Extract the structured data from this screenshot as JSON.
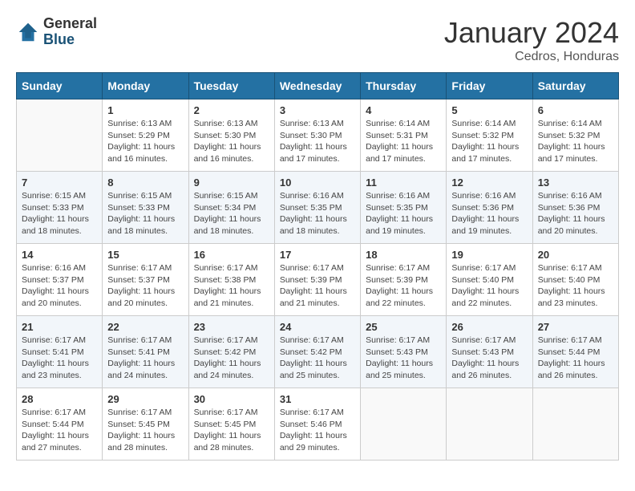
{
  "header": {
    "logo_general": "General",
    "logo_blue": "Blue",
    "month_title": "January 2024",
    "location": "Cedros, Honduras"
  },
  "days_of_week": [
    "Sunday",
    "Monday",
    "Tuesday",
    "Wednesday",
    "Thursday",
    "Friday",
    "Saturday"
  ],
  "weeks": [
    [
      {
        "day": "",
        "info": ""
      },
      {
        "day": "1",
        "info": "Sunrise: 6:13 AM\nSunset: 5:29 PM\nDaylight: 11 hours\nand 16 minutes."
      },
      {
        "day": "2",
        "info": "Sunrise: 6:13 AM\nSunset: 5:30 PM\nDaylight: 11 hours\nand 16 minutes."
      },
      {
        "day": "3",
        "info": "Sunrise: 6:13 AM\nSunset: 5:30 PM\nDaylight: 11 hours\nand 17 minutes."
      },
      {
        "day": "4",
        "info": "Sunrise: 6:14 AM\nSunset: 5:31 PM\nDaylight: 11 hours\nand 17 minutes."
      },
      {
        "day": "5",
        "info": "Sunrise: 6:14 AM\nSunset: 5:32 PM\nDaylight: 11 hours\nand 17 minutes."
      },
      {
        "day": "6",
        "info": "Sunrise: 6:14 AM\nSunset: 5:32 PM\nDaylight: 11 hours\nand 17 minutes."
      }
    ],
    [
      {
        "day": "7",
        "info": "Sunrise: 6:15 AM\nSunset: 5:33 PM\nDaylight: 11 hours\nand 18 minutes."
      },
      {
        "day": "8",
        "info": "Sunrise: 6:15 AM\nSunset: 5:33 PM\nDaylight: 11 hours\nand 18 minutes."
      },
      {
        "day": "9",
        "info": "Sunrise: 6:15 AM\nSunset: 5:34 PM\nDaylight: 11 hours\nand 18 minutes."
      },
      {
        "day": "10",
        "info": "Sunrise: 6:16 AM\nSunset: 5:35 PM\nDaylight: 11 hours\nand 18 minutes."
      },
      {
        "day": "11",
        "info": "Sunrise: 6:16 AM\nSunset: 5:35 PM\nDaylight: 11 hours\nand 19 minutes."
      },
      {
        "day": "12",
        "info": "Sunrise: 6:16 AM\nSunset: 5:36 PM\nDaylight: 11 hours\nand 19 minutes."
      },
      {
        "day": "13",
        "info": "Sunrise: 6:16 AM\nSunset: 5:36 PM\nDaylight: 11 hours\nand 20 minutes."
      }
    ],
    [
      {
        "day": "14",
        "info": "Sunrise: 6:16 AM\nSunset: 5:37 PM\nDaylight: 11 hours\nand 20 minutes."
      },
      {
        "day": "15",
        "info": "Sunrise: 6:17 AM\nSunset: 5:37 PM\nDaylight: 11 hours\nand 20 minutes."
      },
      {
        "day": "16",
        "info": "Sunrise: 6:17 AM\nSunset: 5:38 PM\nDaylight: 11 hours\nand 21 minutes."
      },
      {
        "day": "17",
        "info": "Sunrise: 6:17 AM\nSunset: 5:39 PM\nDaylight: 11 hours\nand 21 minutes."
      },
      {
        "day": "18",
        "info": "Sunrise: 6:17 AM\nSunset: 5:39 PM\nDaylight: 11 hours\nand 22 minutes."
      },
      {
        "day": "19",
        "info": "Sunrise: 6:17 AM\nSunset: 5:40 PM\nDaylight: 11 hours\nand 22 minutes."
      },
      {
        "day": "20",
        "info": "Sunrise: 6:17 AM\nSunset: 5:40 PM\nDaylight: 11 hours\nand 23 minutes."
      }
    ],
    [
      {
        "day": "21",
        "info": "Sunrise: 6:17 AM\nSunset: 5:41 PM\nDaylight: 11 hours\nand 23 minutes."
      },
      {
        "day": "22",
        "info": "Sunrise: 6:17 AM\nSunset: 5:41 PM\nDaylight: 11 hours\nand 24 minutes."
      },
      {
        "day": "23",
        "info": "Sunrise: 6:17 AM\nSunset: 5:42 PM\nDaylight: 11 hours\nand 24 minutes."
      },
      {
        "day": "24",
        "info": "Sunrise: 6:17 AM\nSunset: 5:42 PM\nDaylight: 11 hours\nand 25 minutes."
      },
      {
        "day": "25",
        "info": "Sunrise: 6:17 AM\nSunset: 5:43 PM\nDaylight: 11 hours\nand 25 minutes."
      },
      {
        "day": "26",
        "info": "Sunrise: 6:17 AM\nSunset: 5:43 PM\nDaylight: 11 hours\nand 26 minutes."
      },
      {
        "day": "27",
        "info": "Sunrise: 6:17 AM\nSunset: 5:44 PM\nDaylight: 11 hours\nand 26 minutes."
      }
    ],
    [
      {
        "day": "28",
        "info": "Sunrise: 6:17 AM\nSunset: 5:44 PM\nDaylight: 11 hours\nand 27 minutes."
      },
      {
        "day": "29",
        "info": "Sunrise: 6:17 AM\nSunset: 5:45 PM\nDaylight: 11 hours\nand 28 minutes."
      },
      {
        "day": "30",
        "info": "Sunrise: 6:17 AM\nSunset: 5:45 PM\nDaylight: 11 hours\nand 28 minutes."
      },
      {
        "day": "31",
        "info": "Sunrise: 6:17 AM\nSunset: 5:46 PM\nDaylight: 11 hours\nand 29 minutes."
      },
      {
        "day": "",
        "info": ""
      },
      {
        "day": "",
        "info": ""
      },
      {
        "day": "",
        "info": ""
      }
    ]
  ]
}
